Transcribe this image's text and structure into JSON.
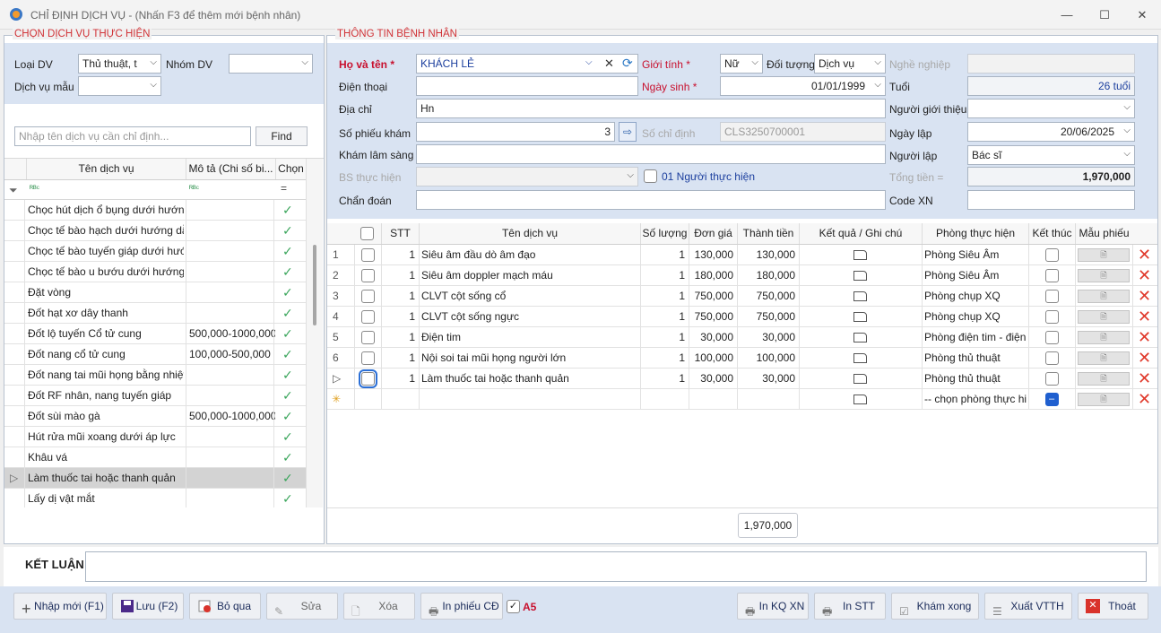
{
  "window": {
    "title": "CHỈ ĐỊNH DỊCH VỤ - (Nhấn F3 để thêm mới bệnh nhân)",
    "min": "—",
    "max": "☐",
    "close": "✕"
  },
  "left": {
    "group_title": "CHỌN DỊCH VỤ THỰC HIỆN",
    "loai_dv_label": "Loại DV",
    "loai_dv_value": "Thủ thuật, t",
    "nhom_dv_label": "Nhóm DV",
    "nhom_dv_value": "",
    "dv_mau_label": "Dịch vụ mẫu",
    "dv_mau_value": "",
    "search_placeholder": "Nhập tên dịch vụ cần chỉ định...",
    "find_label": "Find",
    "columns": [
      "Tên dịch vụ",
      "Mô tả (Chi số bi...",
      "Chọn"
    ],
    "filter_glyph": "ᴿᴮᶜ",
    "rows": [
      {
        "name": "Chọc hút dịch ổ bụng dưới hướng...",
        "desc": ""
      },
      {
        "name": "Chọc tế bào hạch dưới hướng dẫ...",
        "desc": ""
      },
      {
        "name": "Chọc tế bào tuyến giáp dưới hướ...",
        "desc": ""
      },
      {
        "name": "Chọc tế bào u bướu dưới hướng ...",
        "desc": ""
      },
      {
        "name": "Đặt vòng",
        "desc": ""
      },
      {
        "name": "Đốt hạt xơ dây thanh",
        "desc": ""
      },
      {
        "name": "Đốt lộ tuyến Cổ tử cung",
        "desc": "500,000-1000,000"
      },
      {
        "name": "Đốt nang cổ tử cung",
        "desc": "100,000-500,000"
      },
      {
        "name": "Đốt nang tai mũi họng bằng nhiệt",
        "desc": ""
      },
      {
        "name": "Đốt RF nhân, nang tuyến giáp",
        "desc": ""
      },
      {
        "name": "Đốt sùi mào gà",
        "desc": "500,000-1000,000"
      },
      {
        "name": "Hút rửa mũi xoang dưới áp lực",
        "desc": ""
      },
      {
        "name": "Khâu vá",
        "desc": ""
      },
      {
        "name": "Làm thuốc tai hoặc thanh quản",
        "desc": ""
      },
      {
        "name": "Lấy dị vật mắt",
        "desc": ""
      }
    ]
  },
  "patient": {
    "group_title": "THÔNG TIN BỆNH NHÂN",
    "ho_ten_label": "Họ và tên *",
    "ho_ten_value": "KHÁCH LẺ",
    "gioi_tinh_label": "Giới tính *",
    "gioi_tinh_value": "Nữ",
    "doi_tuong_label": "Đối tượng",
    "doi_tuong_value": "Dịch vụ",
    "nghe_nghiep_label": "Nghề nghiệp",
    "nghe_nghiep_value": "",
    "dien_thoai_label": "Điện thoại",
    "dien_thoai_value": "",
    "ngay_sinh_label": "Ngày sinh *",
    "ngay_sinh_value": "01/01/1999",
    "tuoi_label": "Tuổi",
    "tuoi_value": "26 tuổi",
    "dia_chi_label": "Địa chỉ",
    "dia_chi_value": "Hn",
    "nguoi_gioi_thieu_label": "Người giới thiệu",
    "nguoi_gioi_thieu_value": "",
    "so_phieu_label": "Số phiếu khám",
    "so_phieu_value": "3",
    "so_chi_dinh_label": "Số chỉ định",
    "so_chi_dinh_value": "CLS3250700001",
    "ngay_lap_label": "Ngày lập",
    "ngay_lap_value": "20/06/2025",
    "kham_ls_label": "Khám lâm sàng",
    "kham_ls_value": "",
    "nguoi_lap_label": "Người lập",
    "nguoi_lap_value": "Bác sĩ",
    "bs_thuc_hien_label": "BS thực hiện",
    "bs_thuc_hien_value": "",
    "mot_nguoi_label": "01 Người thực hiện",
    "tong_tien_label": "Tổng tiền =",
    "tong_tien_value": "1,970,000",
    "chan_doan_label": "Chẩn đoán",
    "chan_doan_value": "",
    "code_xn_label": "Code XN",
    "code_xn_value": ""
  },
  "services": {
    "columns": [
      "STT",
      "Tên dịch vụ",
      "Số lượng",
      "Đơn giá",
      "Thành tiền",
      "Kết quả / Ghi chú",
      "Phòng thực hiện",
      "Kết thúc",
      "Mẫu phiếu"
    ],
    "rows": [
      {
        "idx": "1",
        "stt": "1",
        "name": "Siêu âm đầu dò âm đạo",
        "qty": "1",
        "price": "130,000",
        "total": "130,000",
        "room": "Phòng Siêu Âm"
      },
      {
        "idx": "2",
        "stt": "1",
        "name": "Siêu âm doppler mạch máu",
        "qty": "1",
        "price": "180,000",
        "total": "180,000",
        "room": "Phòng Siêu Âm"
      },
      {
        "idx": "3",
        "stt": "1",
        "name": " CLVT cột sống cổ",
        "qty": "1",
        "price": "750,000",
        "total": "750,000",
        "room": "Phòng chụp XQ"
      },
      {
        "idx": "4",
        "stt": "1",
        "name": " CLVT cột sống ngực",
        "qty": "1",
        "price": "750,000",
        "total": "750,000",
        "room": "Phòng chụp XQ"
      },
      {
        "idx": "5",
        "stt": "1",
        "name": "Điện tim",
        "qty": "1",
        "price": "30,000",
        "total": "30,000",
        "room": "Phòng điện tim - điện ..."
      },
      {
        "idx": "6",
        "stt": "1",
        "name": "Nội soi tai mũi họng người lớn",
        "qty": "1",
        "price": "100,000",
        "total": "100,000",
        "room": "Phòng thủ thuật"
      },
      {
        "idx": "▷",
        "stt": "1",
        "name": "Làm thuốc tai hoặc thanh quản",
        "qty": "1",
        "price": "30,000",
        "total": "30,000",
        "room": "Phòng thủ thuật"
      }
    ],
    "new_row_room": "-- chọn phòng thực hi...",
    "new_row_marker": "✳",
    "footer_total": "1,970,000"
  },
  "conclusion": {
    "label": "KẾT LUẬN",
    "value": ""
  },
  "toolbar": {
    "new": "Nhập mới (F1)",
    "save": "Lưu (F2)",
    "skip": "Bỏ qua",
    "edit": "Sửa",
    "delete": "Xóa",
    "print_cd": "In phiếu CĐ",
    "a5": "A5",
    "print_kq": "In KQ XN",
    "print_stt": "In STT",
    "done": "Khám xong",
    "export": "Xuất VTTH",
    "exit": "Thoát"
  }
}
